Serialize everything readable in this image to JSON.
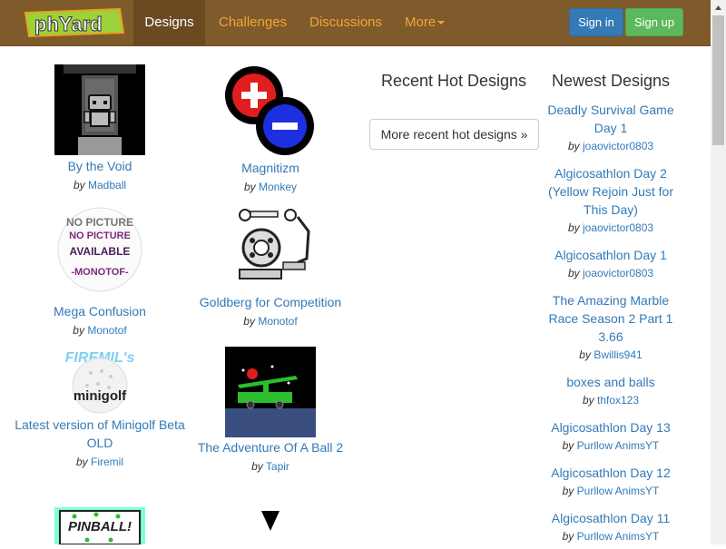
{
  "nav": {
    "logo_text": "phYard",
    "items": [
      "Designs",
      "Challenges",
      "Discussions",
      "More"
    ],
    "signin": "Sign in",
    "signup": "Sign up"
  },
  "by_label": "by",
  "designs": [
    {
      "title": "By the Void",
      "author": "Madball"
    },
    {
      "title": "Magnitizm",
      "author": "Monkey"
    },
    {
      "title": "Mega Confusion",
      "author": "Monotof"
    },
    {
      "title": "Goldberg for Competition",
      "author": "Monotof"
    },
    {
      "title": "Latest version of Minigolf Beta OLD",
      "author": "Firemil"
    },
    {
      "title": "The Adventure Of A Ball 2",
      "author": "Tapir"
    }
  ],
  "thumb_text": {
    "no_picture_1": "NO PICTURE",
    "no_picture_2": "AVAILABLE",
    "no_picture_3": "-MONOTOF-",
    "firemil": "FIREMIL's",
    "minigolf": "minigolf",
    "pinball": "PINBALL!"
  },
  "hot": {
    "title": "Recent Hot Designs",
    "button": "More recent hot designs »"
  },
  "newest": {
    "title": "Newest Designs",
    "items": [
      {
        "title": "Deadly Survival Game Day 1",
        "author": "joaovictor0803"
      },
      {
        "title": "Algicosathlon Day 2 (Yellow Rejoin Just for This Day)",
        "author": "joaovictor0803"
      },
      {
        "title": "Algicosathlon Day 1",
        "author": "joaovictor0803"
      },
      {
        "title": "The Amazing Marble Race Season 2 Part 1 3.66",
        "author": "Bwillis941"
      },
      {
        "title": "boxes and balls",
        "author": "thfox123"
      },
      {
        "title": "Algicosathlon Day 13",
        "author": "Purllow AnimsYT"
      },
      {
        "title": "Algicosathlon Day 12",
        "author": "Purllow AnimsYT"
      },
      {
        "title": "Algicosathlon Day 11",
        "author": "Purllow AnimsYT"
      }
    ]
  },
  "colors": {
    "navbar": "#7f5a2a",
    "nav_link": "#f0a63a",
    "link": "#337ab7",
    "signin": "#337ab7",
    "signup": "#5cb85c"
  }
}
